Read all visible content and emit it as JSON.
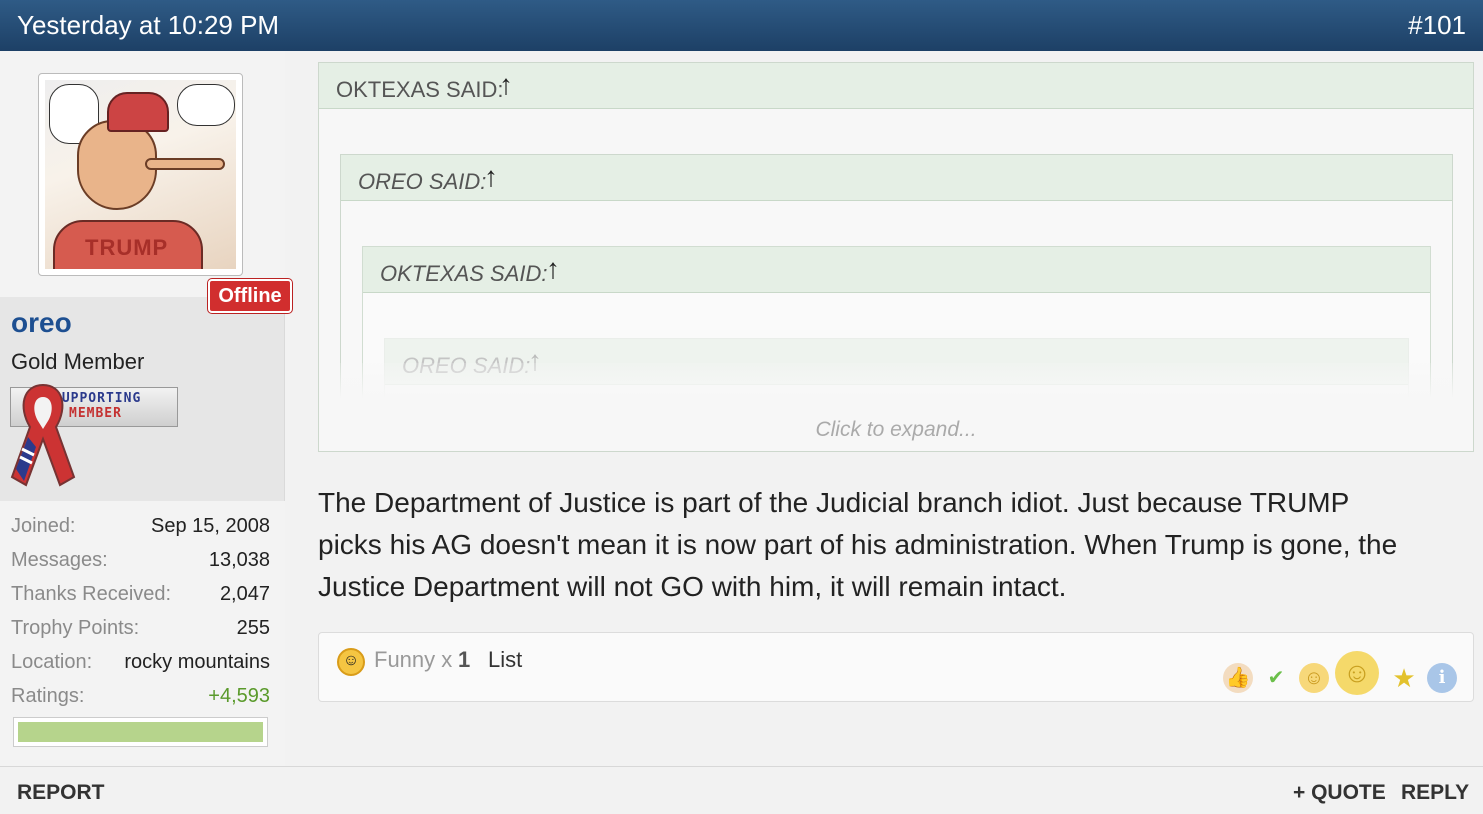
{
  "header": {
    "timestamp": "Yesterday at 10:29 PM",
    "post_number": "#101"
  },
  "user": {
    "status": "Offline",
    "name": "oreo",
    "rank": "Gold Member",
    "badge_line1": "SUPPORTING",
    "badge_line2": "MEMBER",
    "avatar_text": "TRUMP",
    "stats": [
      {
        "label": "Joined:",
        "value": "Sep 15, 2008"
      },
      {
        "label": "Messages:",
        "value": "13,038"
      },
      {
        "label": "Thanks Received:",
        "value": "2,047"
      },
      {
        "label": "Trophy Points:",
        "value": "255"
      },
      {
        "label": "Location:",
        "value": "rocky mountains"
      },
      {
        "label": "Ratings:",
        "value": "+4,593"
      }
    ],
    "rating_fill_percent": 100,
    "colors": {
      "rating_positive": "#5a9a2b",
      "username": "#1d4f91",
      "offline_badge": "#d12e2e"
    }
  },
  "quotes": [
    {
      "label": "OKTEXAS SAID:",
      "arrow": "↑"
    },
    {
      "label": "OREO SAID:",
      "arrow": "↑"
    },
    {
      "label": "OKTEXAS SAID:",
      "arrow": "↑"
    },
    {
      "label": "OREO SAID:",
      "arrow": "↑"
    }
  ],
  "expand_text": "Click to expand...",
  "message": {
    "line1": "The Department of Justice is part of the Judicial branch idiot. Just because TRUMP",
    "line2": "picks his AG doesn't mean it is now part of his administration. When Trump is gone, the",
    "line3": "Justice Department will not GO with him, it will remain intact."
  },
  "reactions": {
    "label": "Funny",
    "multiplier": "x",
    "count": "1",
    "list_link": "List",
    "icons": [
      "thumbs-up-icon",
      "check-icon",
      "funny-icon",
      "winner-icon",
      "star-icon",
      "info-icon"
    ]
  },
  "footer": {
    "report": "REPORT",
    "quote": "+ QUOTE",
    "reply": "REPLY"
  }
}
